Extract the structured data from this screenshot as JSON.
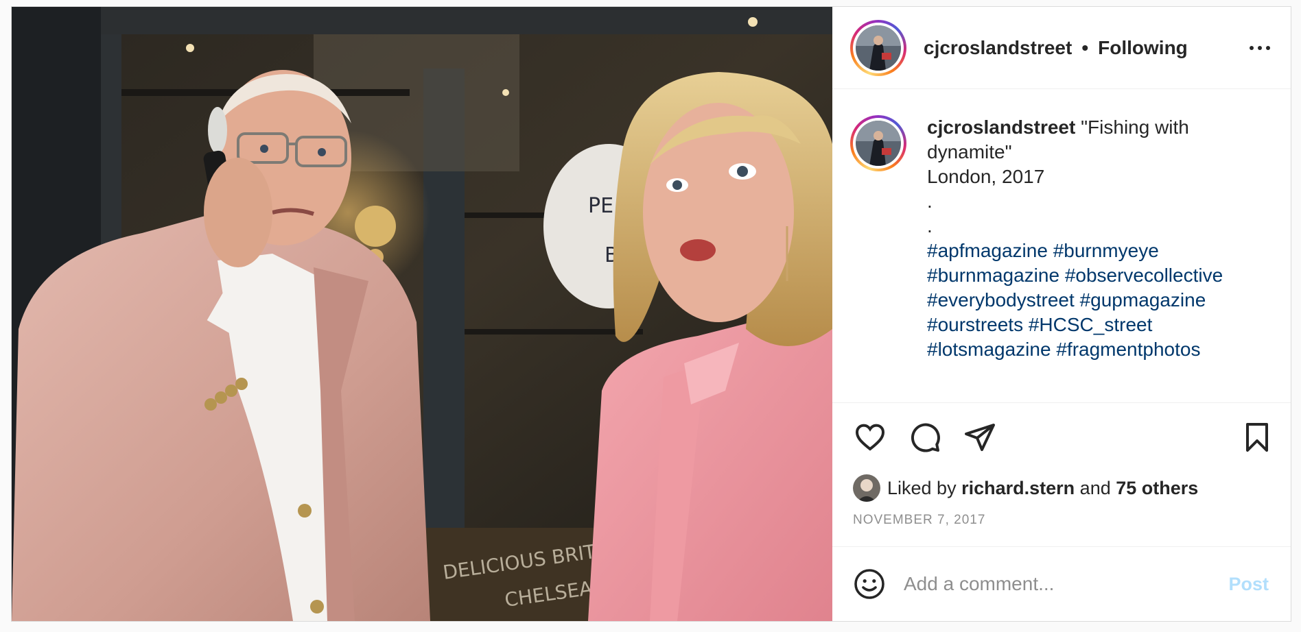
{
  "post": {
    "username": "cjcroslandstreet",
    "separator": "•",
    "follow_status": "Following",
    "photo_sign_text_1": "DELICIOUS BRITISH",
    "photo_sign_text_2": "CHELSEA B",
    "photo_window_text_1": "PE",
    "photo_window_text_2": "B"
  },
  "caption": {
    "username": "cjcroslandstreet",
    "title_line_1": "\"Fishing with",
    "title_line_2": "dynamite\"",
    "location_line": "London, 2017",
    "dot_1": ".",
    "dot_2": ".",
    "hashtags": [
      [
        "#apfmagazine",
        "#burnmyeye"
      ],
      [
        "#burnmagazine",
        "#observecollective"
      ],
      [
        "#everybodystreet",
        "#gupmagazine"
      ],
      [
        "#ourstreets",
        "#HCSC_street"
      ],
      [
        "#lotsmagazine",
        "#fragmentphotos"
      ]
    ]
  },
  "likes": {
    "prefix": "Liked by",
    "liker": "richard.stern",
    "joiner": "and",
    "others": "75 others"
  },
  "date": "NOVEMBER 7, 2017",
  "comment": {
    "placeholder": "Add a comment...",
    "post_label": "Post"
  },
  "icons": {
    "more": "more-horizontal-icon",
    "like": "heart-icon",
    "comment": "comment-bubble-icon",
    "share": "paper-plane-icon",
    "save": "bookmark-icon",
    "emoji": "smiley-icon"
  },
  "colors": {
    "hashtag": "#00376b",
    "text": "#262626",
    "muted": "#8e8e8e",
    "post_button_disabled": "#b2dffc"
  }
}
